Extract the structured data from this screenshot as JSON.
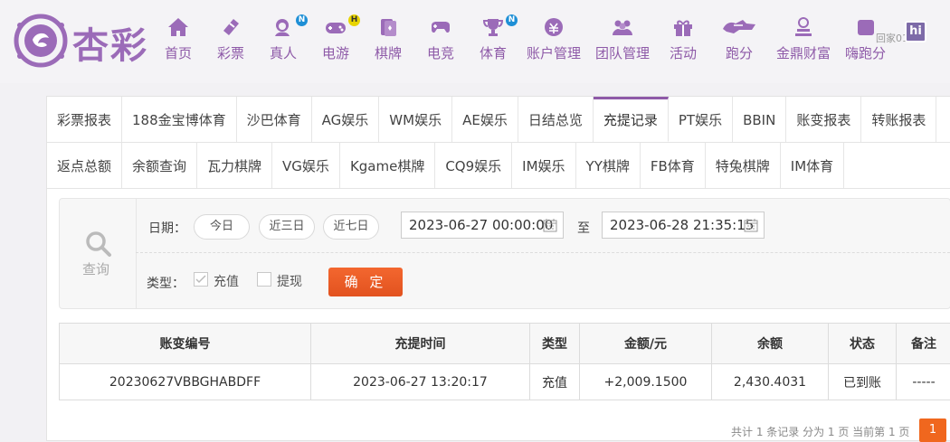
{
  "brand": {
    "name": "杏彩"
  },
  "nav": [
    {
      "label": "首页",
      "icon": "home-icon"
    },
    {
      "label": "彩票",
      "icon": "lottery-icon"
    },
    {
      "label": "真人",
      "icon": "live-dealer-icon",
      "badge": "N"
    },
    {
      "label": "电游",
      "icon": "gamepad-icon",
      "badge": "H"
    },
    {
      "label": "棋牌",
      "icon": "cards-icon"
    },
    {
      "label": "电竞",
      "icon": "esports-controller-icon"
    },
    {
      "label": "体育",
      "icon": "trophy-icon",
      "badge": "N"
    },
    {
      "label": "账户管理",
      "icon": "account-icon"
    },
    {
      "label": "团队管理",
      "icon": "team-icon"
    },
    {
      "label": "活动",
      "icon": "gift-icon"
    },
    {
      "label": "跑分",
      "icon": "run-score-icon"
    },
    {
      "label": "金鼎财富",
      "icon": "wealth-icon"
    },
    {
      "label": "嗨跑分",
      "icon": "hi-score-icon"
    }
  ],
  "watermark": {
    "text": "回家01",
    "box": "hi"
  },
  "tabs": {
    "row1": [
      "彩票报表",
      "188金宝博体育",
      "沙巴体育",
      "AG娱乐",
      "WM娱乐",
      "AE娱乐",
      "日结总览",
      "充提记录",
      "PT娱乐",
      "BBIN",
      "账变报表",
      "转账报表"
    ],
    "row2": [
      "返点总额",
      "余额查询",
      "瓦力棋牌",
      "VG娱乐",
      "Kgame棋牌",
      "CQ9娱乐",
      "IM娱乐",
      "YY棋牌",
      "FB体育",
      "特兔棋牌",
      "IM体育"
    ],
    "active": "充提记录"
  },
  "query": {
    "side_label": "查询",
    "date_label": "日期：",
    "quick": [
      "今日",
      "近三日",
      "近七日"
    ],
    "start": "2023-06-27 00:00:00",
    "to": "至",
    "end": "2023-06-28 21:35:15",
    "type_label": "类型：",
    "types": [
      {
        "label": "充值",
        "checked": true
      },
      {
        "label": "提现",
        "checked": false
      }
    ],
    "confirm": "确 定"
  },
  "table": {
    "headers": [
      "账变编号",
      "充提时间",
      "类型",
      "金额/元",
      "余额",
      "状态",
      "备注"
    ],
    "rows": [
      [
        "20230627VBBGHABDFF",
        "2023-06-27 13:20:17",
        "充值",
        "+2,009.1500",
        "2,430.4031",
        "已到账",
        "-----"
      ]
    ]
  },
  "pager": {
    "summary": "共计 1 条记录  分为 1 页  当前第 1 页",
    "page": "1"
  }
}
